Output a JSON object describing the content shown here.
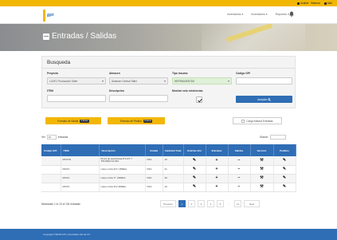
{
  "topbar": {
    "user_label": "Avalluk · Sistema",
    "logout_label": "Salir"
  },
  "logo": {
    "text": "gpi"
  },
  "nav": {
    "items": [
      "Inventarios ▾",
      "Inventarios ▾",
      "Reportes ▾"
    ]
  },
  "page": {
    "title": "Entradas / Salidas"
  },
  "search": {
    "title": "Busqueda",
    "proyecto": {
      "label": "Proyecto",
      "value": "LUXE1 Producción Taller"
    },
    "almacen": {
      "label": "Almacen",
      "value": "Almacen Central Taller"
    },
    "tipo_insumo": {
      "label": "Tipo Insumo",
      "value": "HERRAMIENTAS"
    },
    "codigo_gpi": {
      "label": "Código GPI",
      "value": ""
    },
    "item": {
      "label": "ITEM",
      "value": ""
    },
    "descripcion": {
      "label": "Descripción",
      "value": ""
    },
    "existencias": {
      "label": "Mostrar solo existencias",
      "checked": true
    },
    "submit_label": "Aceptar"
  },
  "actions": {
    "formato_salida": {
      "label": "Formato de Salida",
      "count": "0 Items"
    },
    "formato_entrada": {
      "label": "Formato de Pedido",
      "count": "0 Items"
    },
    "carga_masiva": "Carga Masiva Entradas"
  },
  "datatable": {
    "show_label": "Ver",
    "page_size": "10",
    "entries_label": "entradas",
    "search_label": "Search:"
  },
  "table": {
    "headers": [
      "Código GPI",
      "ITEM",
      "Descripción",
      "Unidad",
      "Cantidad Total",
      "Solicitar Info",
      "Entradas",
      "Salidas",
      "Servicio",
      "Pedidos"
    ],
    "rows": [
      {
        "codigo": "",
        "item": "MCSTE",
        "desc1": "Pinza de electricista 8\"2.0/7.7",
        "desc2": "TRUPER FA.IDA",
        "unidad": "PZA",
        "cantidad": "10"
      },
      {
        "codigo": "",
        "item": "MCN3",
        "desc1": "Llave mixta 3/4\" URREA",
        "desc2": "",
        "unidad": "PZA",
        "cantidad": "21"
      },
      {
        "codigo": "",
        "item": "MCN3",
        "desc1": "Llave mixta 7/\" URREA",
        "desc2": "",
        "unidad": "PZA",
        "cantidad": "40"
      },
      {
        "codigo": "",
        "item": "MCN3",
        "desc1": "Llave mixta 3/4 URREA",
        "desc2": "",
        "unidad": "PZA",
        "cantidad": "10"
      }
    ]
  },
  "footer_info": {
    "showing": "Mostrando 1 to 10 of 104 entradas"
  },
  "pagination": {
    "prev": "Previous",
    "pages": [
      "1",
      "2",
      "3",
      "4",
      "5",
      "…",
      "11"
    ],
    "next": "Next"
  },
  "footer": {
    "copyright": "Copyright ©2018 GPI y Asociados SA de CV"
  },
  "colors": {
    "primary": "#2f6db5",
    "accent": "#f2b705"
  }
}
